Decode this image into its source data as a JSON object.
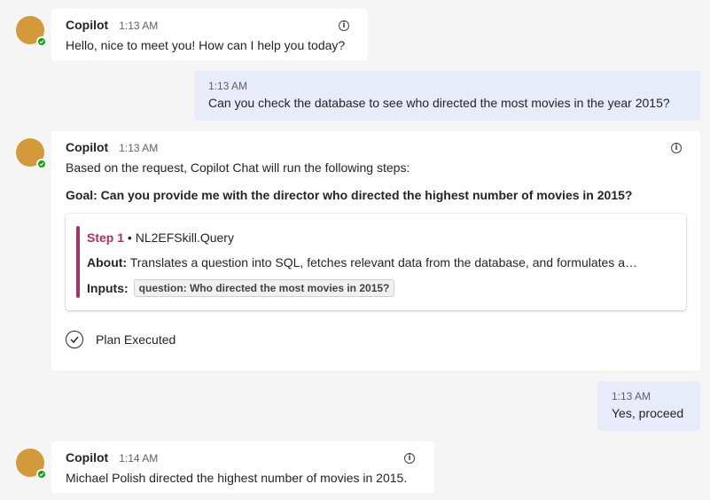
{
  "messages": [
    {
      "sender": "Copilot",
      "time": "1:13 AM",
      "text": "Hello, nice to meet you! How can I help you today?"
    },
    {
      "time": "1:13 AM",
      "text": "Can you check the database to see who directed the most movies in the year 2015?"
    },
    {
      "sender": "Copilot",
      "time": "1:13 AM",
      "intro": "Based on the request, Copilot Chat will run the following steps:",
      "goal": "Goal: Can you provide me with the director who directed the highest number of movies in 2015?",
      "step": {
        "label": "Step 1",
        "separator": "•",
        "skill": "NL2EFSkill.Query",
        "about_label": "About:",
        "about_text": "Translates a question into SQL, fetches relevant data from the database, and formulates a…",
        "inputs_label": "Inputs:",
        "input_chip": "question: Who directed the most movies in 2015?"
      },
      "status": "Plan Executed"
    },
    {
      "time": "1:13 AM",
      "text": "Yes, proceed"
    },
    {
      "sender": "Copilot",
      "time": "1:14 AM",
      "text": "Michael Polish directed the highest number of movies in 2015."
    }
  ],
  "colors": {
    "background": "#f5f5f5",
    "bot_bubble": "#ffffff",
    "user_bubble": "#e8ebfa",
    "avatar": "#d39a3c",
    "presence": "#13a10e",
    "step_accent": "#a4336a"
  },
  "icons": [
    "copilot-avatar",
    "presence-available-icon",
    "info-icon",
    "check-circle-icon"
  ]
}
